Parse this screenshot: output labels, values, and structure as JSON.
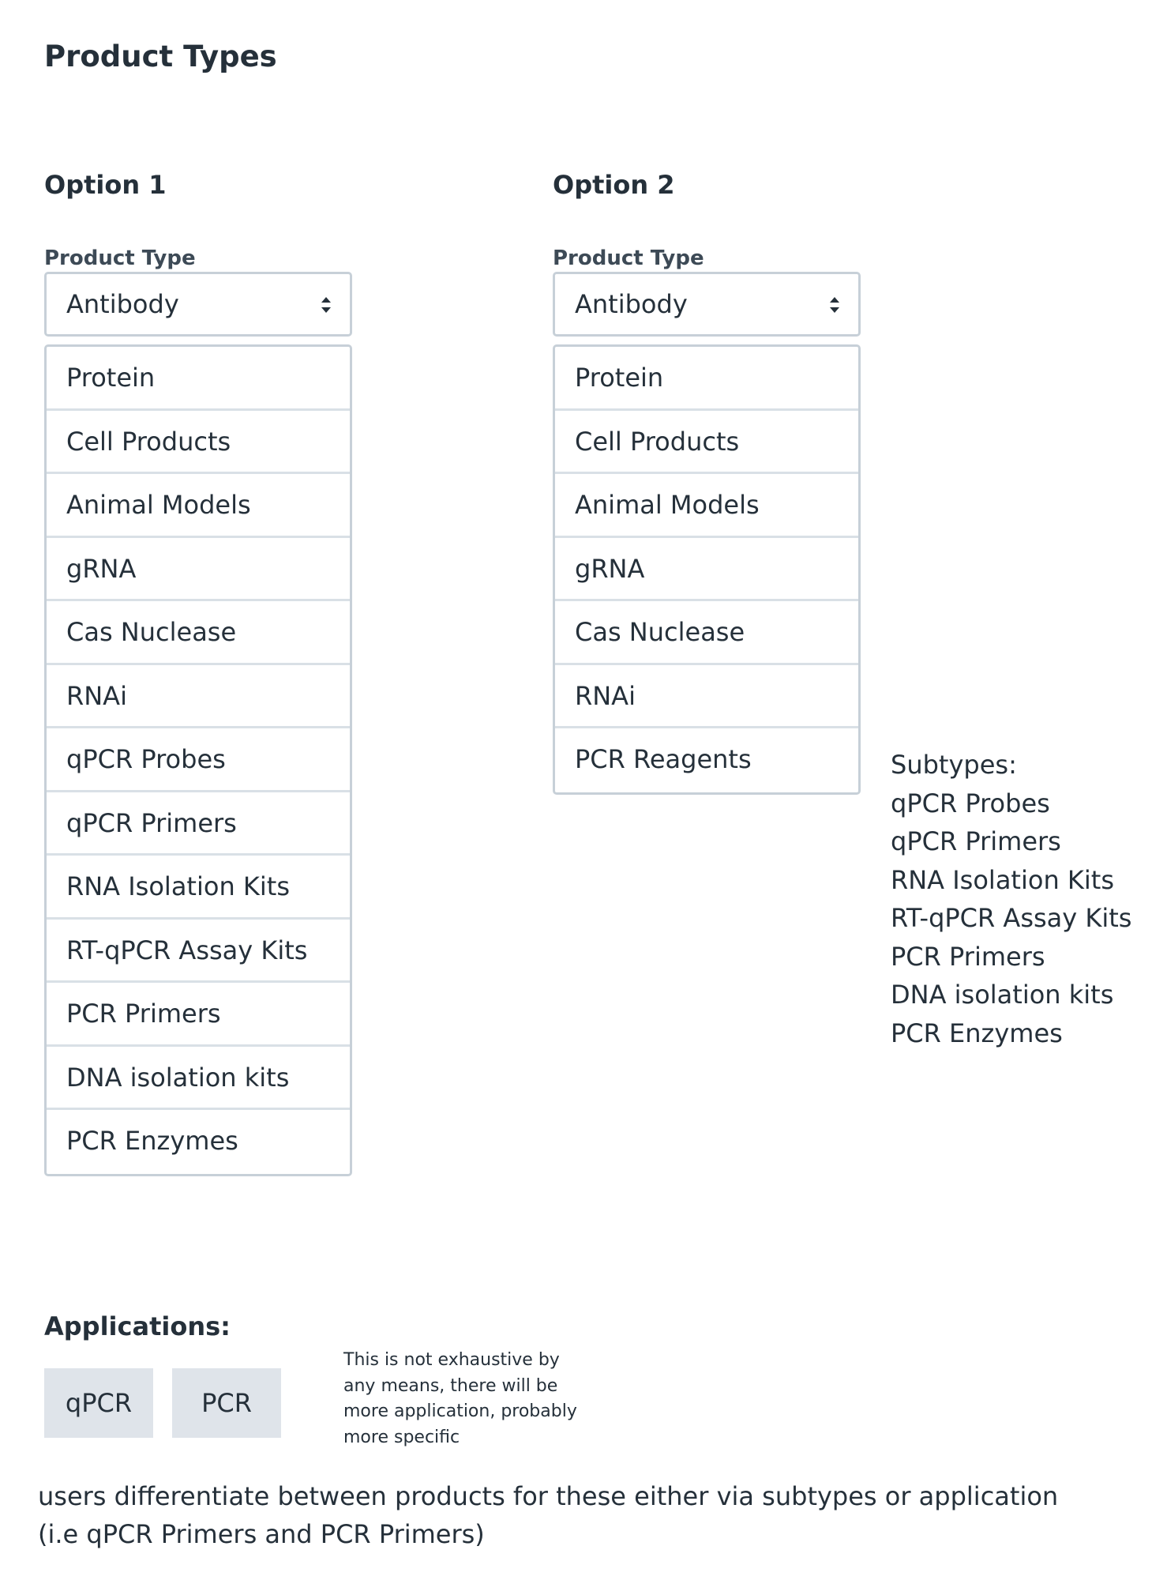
{
  "page": {
    "title": "Product Types"
  },
  "options": [
    {
      "title": "Option 1",
      "field_label": "Product Type",
      "selected": "Antibody",
      "items": [
        "Protein",
        "Cell Products",
        "Animal Models",
        "gRNA",
        "Cas Nuclease",
        "RNAi",
        "qPCR Probes",
        "qPCR Primers",
        "RNA Isolation Kits",
        "RT-qPCR Assay Kits",
        "PCR Primers",
        "DNA isolation kits",
        "PCR Enzymes"
      ]
    },
    {
      "title": "Option 2",
      "field_label": "Product Type",
      "selected": "Antibody",
      "items": [
        "Protein",
        "Cell Products",
        "Animal Models",
        "gRNA",
        "Cas Nuclease",
        "RNAi",
        "PCR Reagents"
      ]
    }
  ],
  "subtypes": {
    "heading": "Subtypes:",
    "items": [
      "qPCR Probes",
      "qPCR Primers",
      "RNA Isolation Kits",
      "RT-qPCR Assay Kits",
      "PCR Primers",
      "DNA isolation kits",
      "PCR Enzymes"
    ]
  },
  "applications": {
    "title": "Applications:",
    "chips": [
      "qPCR",
      "PCR"
    ],
    "note_lines": [
      "This is not exhaustive by",
      "any means, there will be",
      "more application, probably",
      "more specific"
    ]
  },
  "footer": {
    "lines": [
      "users differentiate between products for these either via subtypes or application",
      "(i.e qPCR Primers and PCR Primers)"
    ]
  },
  "icons": {
    "select_arrow": "sort-arrows-icon"
  }
}
